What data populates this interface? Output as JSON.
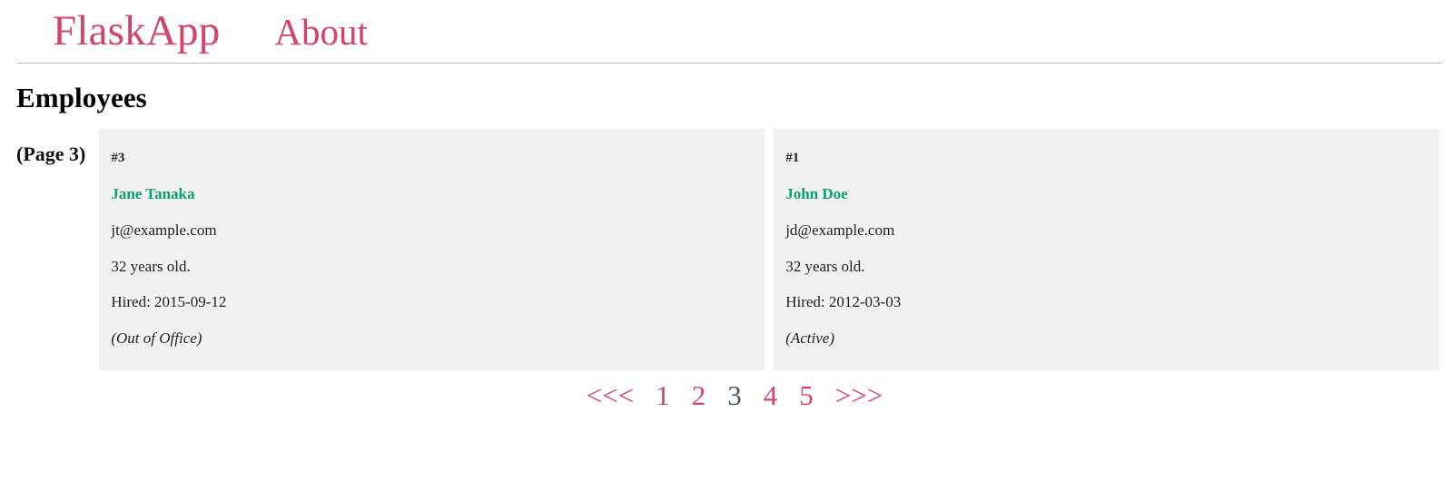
{
  "navbar": {
    "brand": "FlaskApp",
    "links": [
      {
        "label": "About"
      }
    ]
  },
  "heading": {
    "title": "Employees",
    "page_label": "(Page 3)"
  },
  "employees": [
    {
      "id": "#3",
      "name": "Jane Tanaka",
      "email": "jt@example.com",
      "age": "32 years old.",
      "hired": "Hired: 2015-09-12",
      "status": "(Out of Office)"
    },
    {
      "id": "#1",
      "name": "John Doe",
      "email": "jd@example.com",
      "age": "32 years old.",
      "hired": "Hired: 2012-03-03",
      "status": "(Active)"
    }
  ],
  "pagination": {
    "prev": "<<<",
    "next": ">>>",
    "pages": [
      "1",
      "2",
      "3",
      "4",
      "5"
    ],
    "current": "3"
  },
  "colors": {
    "accent": "#d4436a",
    "name_green": "#07a172",
    "card_bg": "#f1f1f1",
    "current_page": "#4c5560",
    "divider": "#b9b9b9"
  }
}
